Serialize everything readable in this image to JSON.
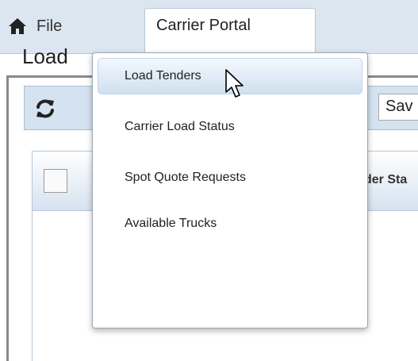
{
  "menubar": {
    "home_icon": "home-icon",
    "file_label": "File",
    "portal_tab_label": "Carrier Portal"
  },
  "dropdown": {
    "items": [
      {
        "label": "Load Tenders",
        "active": true
      },
      {
        "label": "Carrier Load Status",
        "active": false
      },
      {
        "label": "Spot Quote Requests",
        "active": false
      },
      {
        "label": "Available Trucks",
        "active": false
      }
    ]
  },
  "page": {
    "title_partial": "Load",
    "refresh_icon": "refresh-icon",
    "save_partial": "Sav",
    "column_status_partial": "der Sta"
  },
  "colors": {
    "menubar_bg": "#dbe6f1",
    "active_item": "#cfe0f0",
    "toolbar_bg": "#d5e2ef"
  }
}
